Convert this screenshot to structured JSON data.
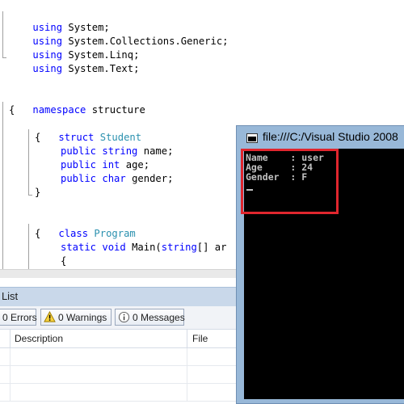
{
  "editor": {
    "lines": [
      {
        "text": "using System;"
      },
      {
        "text": "using System.Collections.Generic;"
      },
      {
        "text": "using System.Linq;"
      },
      {
        "text": "using System.Text;"
      },
      {
        "text": "namespace structure"
      },
      {
        "text": "{"
      },
      {
        "text": "struct Student"
      },
      {
        "text": "{"
      },
      {
        "text": "public string name;"
      },
      {
        "text": "public int age;"
      },
      {
        "text": "public char gender;"
      },
      {
        "text": "}"
      },
      {
        "text": "class Program"
      },
      {
        "text": "{"
      },
      {
        "text": "static void Main(string[] ar"
      },
      {
        "text": "{"
      }
    ]
  },
  "error_list": {
    "title": "r List",
    "errors_label": "0 Errors",
    "warnings_label": "0 Warnings",
    "messages_label": "0 Messages",
    "columns": {
      "description": "Description",
      "file": "File"
    }
  },
  "console": {
    "title": "file:///C:/Visual Studio 2008",
    "output": [
      "Name    : user",
      "Age     : 24",
      "Gender  : F"
    ]
  },
  "colors": {
    "keyword": "#0000ff",
    "type": "#2b91af",
    "highlight": "#e0262e"
  }
}
